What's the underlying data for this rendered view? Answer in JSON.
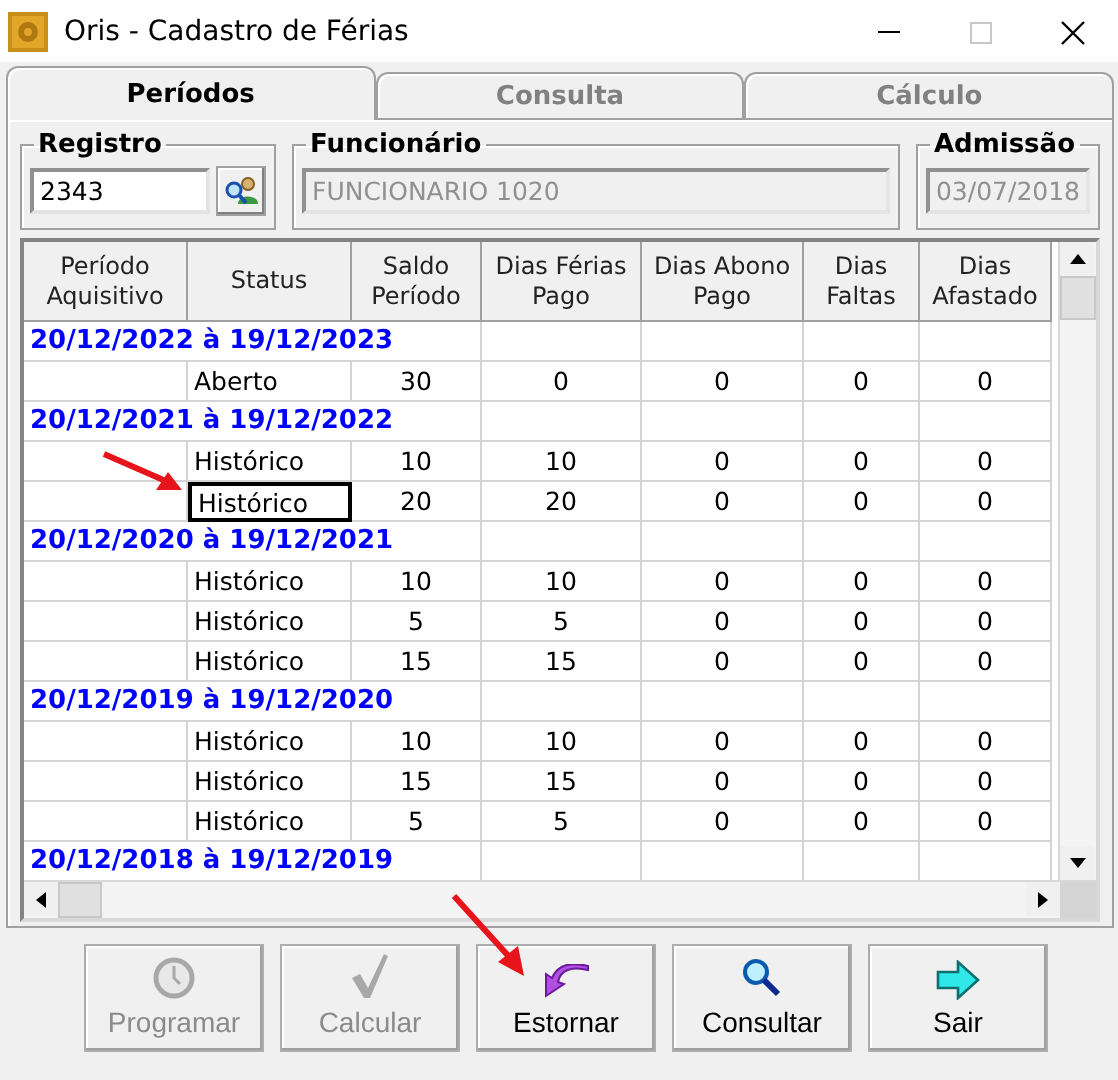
{
  "window": {
    "title": "Oris - Cadastro de Férias",
    "maximize_disabled": true
  },
  "tabs": [
    {
      "label": "Períodos",
      "selected": true
    },
    {
      "label": "Consulta",
      "selected": false
    },
    {
      "label": "Cálculo",
      "selected": false
    }
  ],
  "fields": [
    {
      "label": "Registro",
      "value": "2343",
      "disabled": false,
      "lookup": true
    },
    {
      "label": "Funcionário",
      "value": "FUNCIONARIO 1020",
      "disabled": true
    },
    {
      "label": "Admissão",
      "value": "03/07/2018",
      "disabled": true
    }
  ],
  "table": {
    "columns": [
      "Período Aquisitivo",
      "Status",
      "Saldo Período",
      "Dias Férias Pago",
      "Dias Abono Pago",
      "Dias Faltas",
      "Dias Afastado"
    ],
    "groups": [
      {
        "period": "20/12/2022 à 19/12/2023",
        "rows": [
          {
            "status": "Aberto",
            "cells": [
              "30",
              "0",
              "0",
              "0",
              "0"
            ],
            "selected": false
          }
        ]
      },
      {
        "period": "20/12/2021 à 19/12/2022",
        "rows": [
          {
            "status": "Histórico",
            "cells": [
              "10",
              "10",
              "0",
              "0",
              "0"
            ],
            "selected": false
          },
          {
            "status": "Histórico",
            "cells": [
              "20",
              "20",
              "0",
              "0",
              "0"
            ],
            "selected": true
          }
        ]
      },
      {
        "period": "20/12/2020 à 19/12/2021",
        "rows": [
          {
            "status": "Histórico",
            "cells": [
              "10",
              "10",
              "0",
              "0",
              "0"
            ],
            "selected": false
          },
          {
            "status": "Histórico",
            "cells": [
              "5",
              "5",
              "0",
              "0",
              "0"
            ],
            "selected": false
          },
          {
            "status": "Histórico",
            "cells": [
              "15",
              "15",
              "0",
              "0",
              "0"
            ],
            "selected": false
          }
        ]
      },
      {
        "period": "20/12/2019 à 19/12/2020",
        "rows": [
          {
            "status": "Histórico",
            "cells": [
              "10",
              "10",
              "0",
              "0",
              "0"
            ],
            "selected": false
          },
          {
            "status": "Histórico",
            "cells": [
              "15",
              "15",
              "0",
              "0",
              "0"
            ],
            "selected": false
          },
          {
            "status": "Histórico",
            "cells": [
              "5",
              "5",
              "0",
              "0",
              "0"
            ],
            "selected": false
          }
        ]
      },
      {
        "period": "20/12/2018 à 19/12/2019"
      }
    ]
  },
  "buttons": [
    {
      "label": "Programar",
      "kind": "clock",
      "disabled": true
    },
    {
      "label": "Calcular",
      "kind": "check",
      "disabled": true
    },
    {
      "label": "Estornar",
      "kind": "undo",
      "disabled": false
    },
    {
      "label": "Consultar",
      "kind": "search",
      "disabled": false
    },
    {
      "label": "Sair",
      "kind": "exit",
      "disabled": false
    }
  ]
}
